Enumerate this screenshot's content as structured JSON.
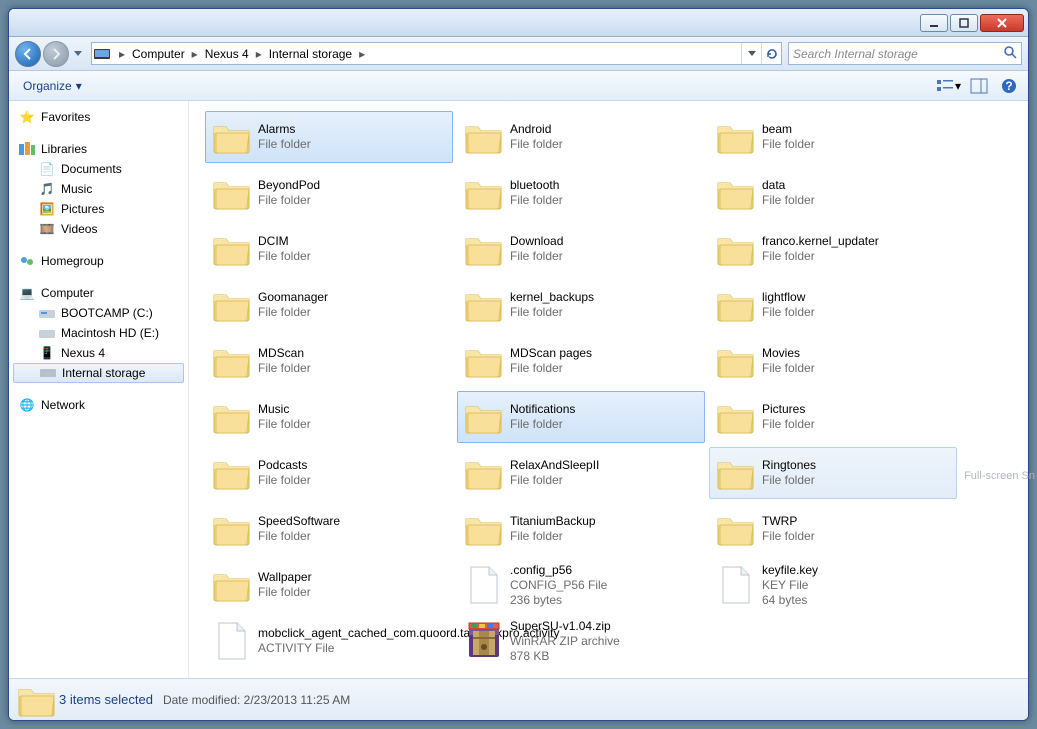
{
  "breadcrumb": [
    "Computer",
    "Nexus 4",
    "Internal storage"
  ],
  "search_placeholder": "Search Internal storage",
  "toolbar": {
    "organize": "Organize"
  },
  "nav": {
    "favorites": "Favorites",
    "libraries": "Libraries",
    "lib_items": [
      "Documents",
      "Music",
      "Pictures",
      "Videos"
    ],
    "homegroup": "Homegroup",
    "computer": "Computer",
    "drives": [
      "BOOTCAMP (C:)",
      "Macintosh HD (E:)",
      "Nexus 4"
    ],
    "internal": "Internal storage",
    "network": "Network"
  },
  "folder_type": "File folder",
  "items": [
    {
      "name": "Alarms",
      "type": "File folder",
      "sel": "sel"
    },
    {
      "name": "Android",
      "type": "File folder"
    },
    {
      "name": "beam",
      "type": "File folder"
    },
    {
      "name": "BeyondPod",
      "type": "File folder"
    },
    {
      "name": "bluetooth",
      "type": "File folder"
    },
    {
      "name": "data",
      "type": "File folder"
    },
    {
      "name": "DCIM",
      "type": "File folder"
    },
    {
      "name": "Download",
      "type": "File folder"
    },
    {
      "name": "franco.kernel_updater",
      "type": "File folder"
    },
    {
      "name": "Goomanager",
      "type": "File folder"
    },
    {
      "name": "kernel_backups",
      "type": "File folder"
    },
    {
      "name": "lightflow",
      "type": "File folder"
    },
    {
      "name": "MDScan",
      "type": "File folder"
    },
    {
      "name": "MDScan pages",
      "type": "File folder"
    },
    {
      "name": "Movies",
      "type": "File folder"
    },
    {
      "name": "Music",
      "type": "File folder"
    },
    {
      "name": "Notifications",
      "type": "File folder",
      "sel": "sel"
    },
    {
      "name": "Pictures",
      "type": "File folder"
    },
    {
      "name": "Podcasts",
      "type": "File folder"
    },
    {
      "name": "RelaxAndSleepII",
      "type": "File folder"
    },
    {
      "name": "Ringtones",
      "type": "File folder",
      "sel": "selalt"
    },
    {
      "name": "SpeedSoftware",
      "type": "File folder"
    },
    {
      "name": "TitaniumBackup",
      "type": "File folder"
    },
    {
      "name": "TWRP",
      "type": "File folder"
    },
    {
      "name": "Wallpaper",
      "type": "File folder"
    },
    {
      "name": ".config_p56",
      "type": "CONFIG_P56 File",
      "extra": "236 bytes",
      "icon": "file"
    },
    {
      "name": "keyfile.key",
      "type": "KEY File",
      "extra": "64 bytes",
      "icon": "file"
    },
    {
      "name": "mobclick_agent_cached_com.quoord.tapatalkpro.activity",
      "type": "ACTIVITY File",
      "icon": "file"
    },
    {
      "name": "SuperSU-v1.04.zip",
      "type": "WinRAR ZIP archive",
      "extra": "878 KB",
      "icon": "zip"
    }
  ],
  "status": {
    "title": "3 items selected",
    "mod_label": "Date modified:",
    "mod_value": "2/23/2013 11:25 AM"
  },
  "snip": "Full-screen Sn"
}
